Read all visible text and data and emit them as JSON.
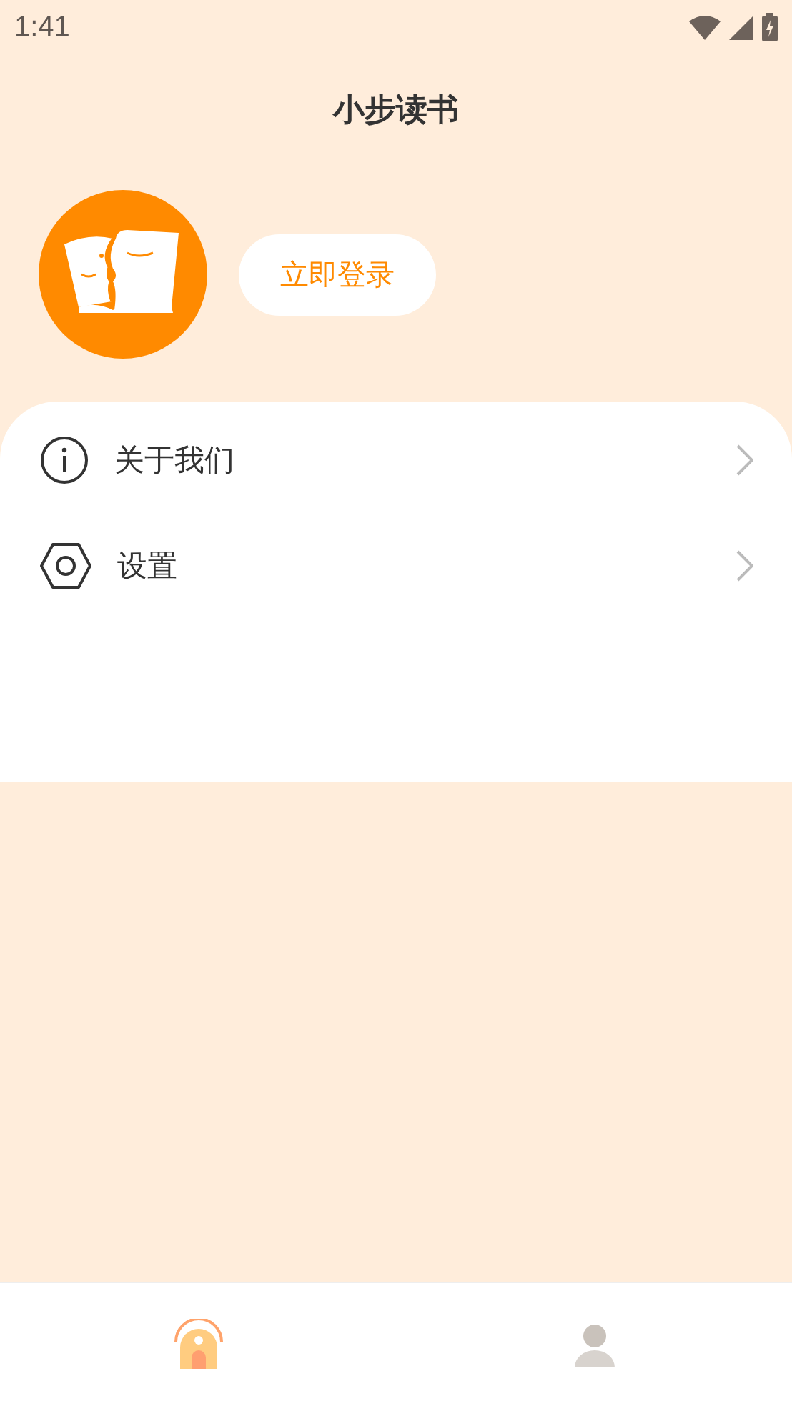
{
  "status_bar": {
    "time": "1:41"
  },
  "title": "小步读书",
  "profile": {
    "login_button": "立即登录"
  },
  "menu": [
    {
      "kind": "info",
      "label": "关于我们"
    },
    {
      "kind": "settings",
      "label": "设置"
    }
  ],
  "tabs": [
    {
      "kind": "home",
      "selected": true
    },
    {
      "kind": "profile",
      "selected": false
    }
  ]
}
